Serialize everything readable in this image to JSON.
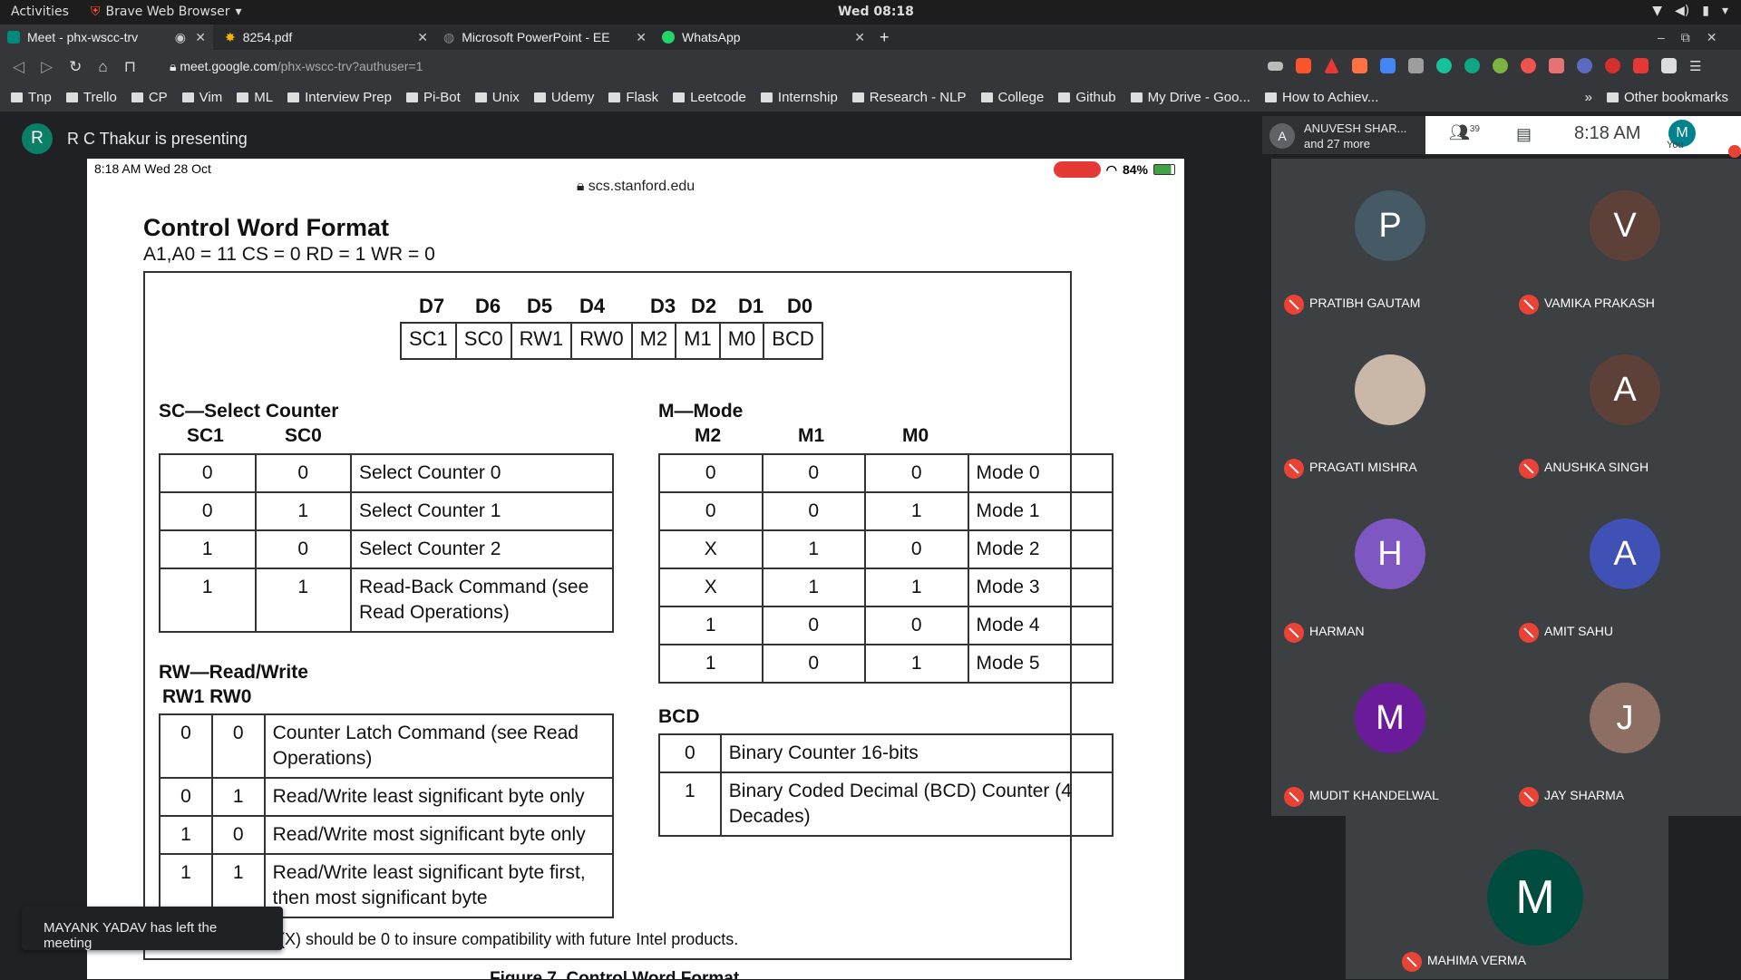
{
  "os": {
    "activities": "Activities",
    "app": "Brave Web Browser",
    "clock": "Wed 08:18"
  },
  "tabs": [
    {
      "title": "Meet - phx-wscc-trv",
      "favicon": "meet-icon",
      "color": "#00897b"
    },
    {
      "title": "8254.pdf",
      "favicon": "pdf-icon",
      "color": "#f4b400"
    },
    {
      "title": "Microsoft PowerPoint - EE",
      "favicon": "globe-icon",
      "color": "#888888"
    },
    {
      "title": "WhatsApp",
      "favicon": "whatsapp-icon",
      "color": "#25d366"
    }
  ],
  "address": {
    "host": "meet.google.com",
    "path": "/phx-wscc-trv?authuser=1"
  },
  "bookmarks": [
    "Tnp",
    "Trello",
    "CP",
    "Vim",
    "ML",
    "Interview Prep",
    "Pi-Bot",
    "Unix",
    "Udemy",
    "Flask",
    "Leetcode",
    "Internship",
    "Research - NLP",
    "College",
    "Github",
    "My Drive - Goo...",
    "How to Achiev..."
  ],
  "bookmarks_more": "»",
  "other_bookmarks": "Other bookmarks",
  "meet": {
    "presenter_initial": "R",
    "presenting": "R C Thakur is presenting",
    "group_initial": "A",
    "group_name": "ANUVESH SHAR...",
    "group_more": "and 27 more",
    "participants_count": "39",
    "time": "8:18 AM",
    "you_initial": "M",
    "you_label": "You",
    "toast": "MAYANK YADAV has left the meeting"
  },
  "slide": {
    "status_time": "8:18 AM   Wed 28 Oct",
    "battery": "84%",
    "domain": "scs.stanford.edu",
    "title": "Control Word Format",
    "subtitle": "A1,A0 = 11   CS = 0   RD = 1   WR = 0",
    "bits_labels": [
      "D7",
      "D6",
      "D5",
      "D4",
      "D3",
      "D2",
      "D1",
      "D0"
    ],
    "bits": [
      "SC1",
      "SC0",
      "RW1",
      "RW0",
      "M2",
      "M1",
      "M0",
      "BCD"
    ],
    "sc_title": "SC—Select Counter",
    "sc_cols": [
      "SC1",
      "SC0"
    ],
    "sc_rows": [
      [
        "0",
        "0",
        "Select Counter 0"
      ],
      [
        "0",
        "1",
        "Select Counter 1"
      ],
      [
        "1",
        "0",
        "Select Counter 2"
      ],
      [
        "1",
        "1",
        "Read-Back Command (see Read Operations)"
      ]
    ],
    "m_title": "M—Mode",
    "m_cols": [
      "M2",
      "M1",
      "M0"
    ],
    "m_rows": [
      [
        "0",
        "0",
        "0",
        "Mode 0"
      ],
      [
        "0",
        "0",
        "1",
        "Mode 1"
      ],
      [
        "X",
        "1",
        "0",
        "Mode 2"
      ],
      [
        "X",
        "1",
        "1",
        "Mode 3"
      ],
      [
        "1",
        "0",
        "0",
        "Mode 4"
      ],
      [
        "1",
        "0",
        "1",
        "Mode 5"
      ]
    ],
    "rw_title": "RW—Read/Write",
    "rw_cols": "RW1 RW0",
    "rw_rows": [
      [
        "0",
        "0",
        "Counter Latch Command (see Read Operations)"
      ],
      [
        "0",
        "1",
        "Read/Write least significant byte only"
      ],
      [
        "1",
        "0",
        "Read/Write most significant byte only"
      ],
      [
        "1",
        "1",
        "Read/Write least significant byte first, then most significant byte"
      ]
    ],
    "bcd_title": "BCD",
    "bcd_rows": [
      [
        "0",
        "Binary Counter 16-bits"
      ],
      [
        "1",
        "Binary Coded Decimal (BCD) Counter (4 Decades)"
      ]
    ],
    "note": "(X) should be 0 to insure compatibility with future Intel products.",
    "caption": "Figure 7. Control Word Format"
  },
  "participants": [
    {
      "initial": "P",
      "name": "PRATIBH GAUTAM",
      "color": "#455a64"
    },
    {
      "initial": "V",
      "name": "VAMIKA PRAKASH",
      "color": "#5d4037"
    },
    {
      "initial": "",
      "name": "PRAGATI MISHRA",
      "color": "#c9b8a8"
    },
    {
      "initial": "A",
      "name": "ANUSHKA SINGH",
      "color": "#5d4037"
    },
    {
      "initial": "H",
      "name": "HARMAN",
      "color": "#7e57c2"
    },
    {
      "initial": "A",
      "name": "AMIT SAHU",
      "color": "#3f51b5"
    },
    {
      "initial": "M",
      "name": "MUDIT KHANDELWAL",
      "color": "#6a1b9a"
    },
    {
      "initial": "J",
      "name": "JAY SHARMA",
      "color": "#8d6e63"
    },
    {
      "initial": "M",
      "name": "MAHIMA VERMA",
      "color": "#004d40"
    }
  ]
}
